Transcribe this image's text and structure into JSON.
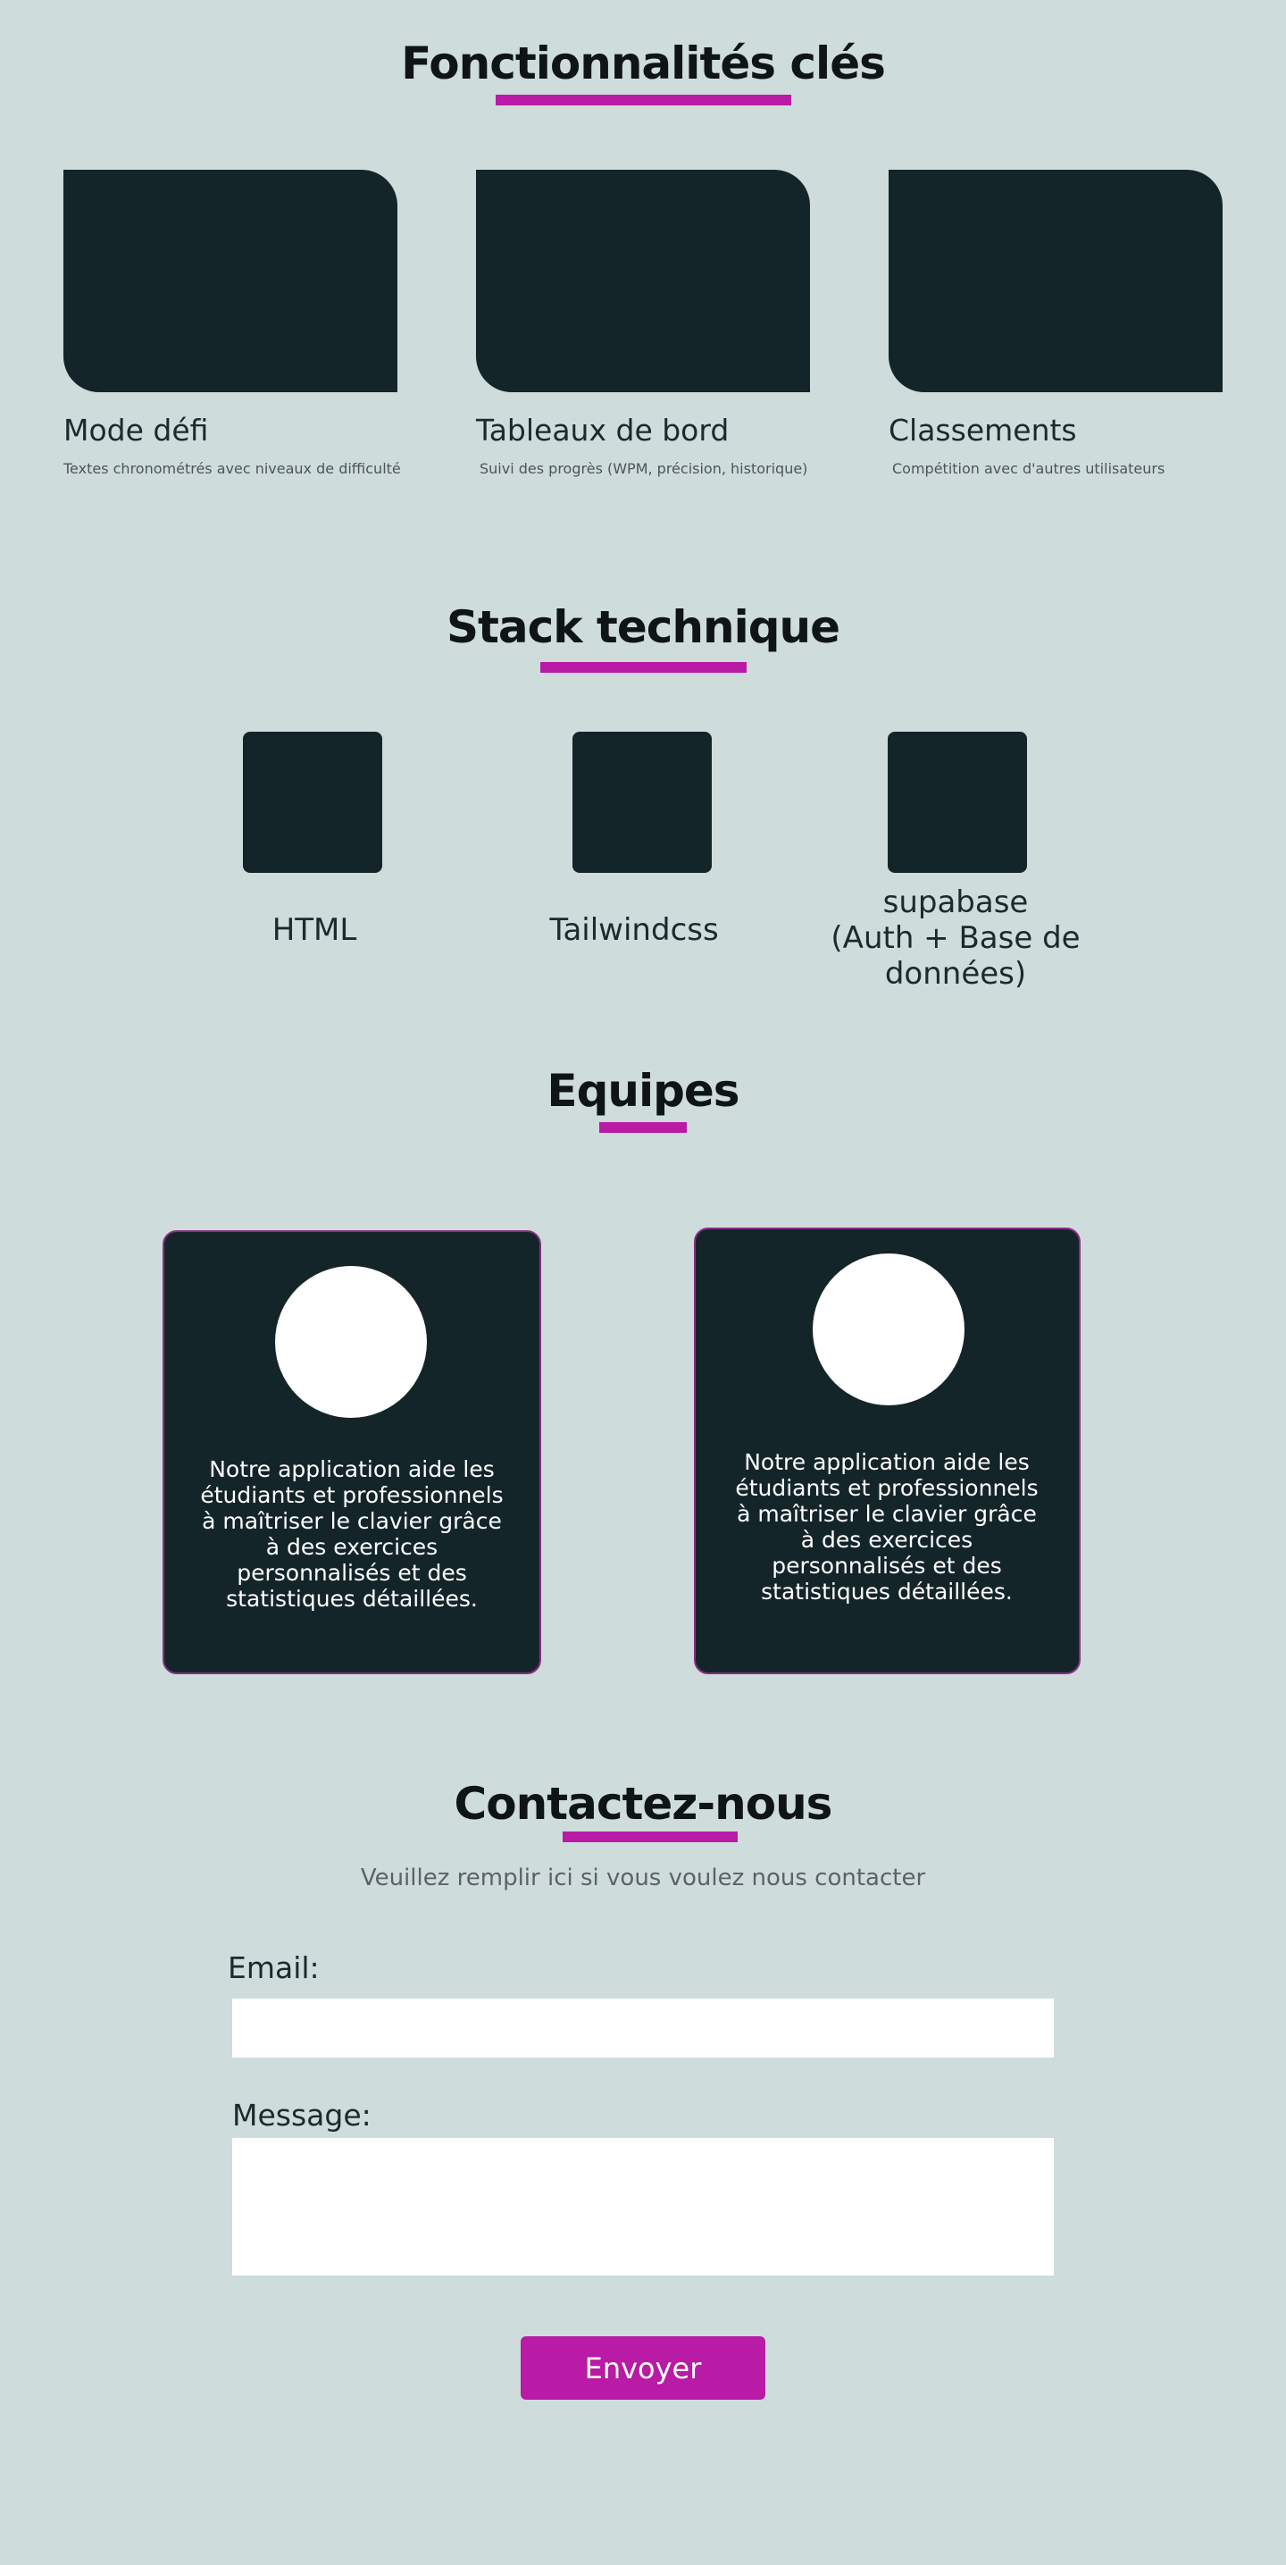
{
  "features": {
    "title": "Fonctionnalités clés",
    "items": [
      {
        "title": "Mode défi",
        "desc": "Textes chronométrés avec niveaux de difficulté"
      },
      {
        "title": "Tableaux de bord",
        "desc": "Suivi des progrès (WPM, précision, historique)"
      },
      {
        "title": "Classements",
        "desc": "Compétition avec d'autres utilisateurs"
      }
    ]
  },
  "stack": {
    "title": "Stack technique",
    "items": [
      {
        "label": "HTML"
      },
      {
        "label": "Tailwindcss"
      },
      {
        "label_line1": "supabase",
        "label_line2": "(Auth + Base de données)"
      }
    ]
  },
  "team": {
    "title": "Equipes",
    "members": [
      {
        "text": "Notre application aide les étudiants et professionnels à maîtriser le clavier grâce à des exercices personnalisés et des statistiques détaillées."
      },
      {
        "text": "Notre application aide les étudiants et professionnels à maîtriser le clavier grâce à des exercices personnalisés et des statistiques détaillées."
      }
    ]
  },
  "contact": {
    "title": "Contactez-nous",
    "subtitle": "Veuillez remplir ici si vous voulez nous contacter",
    "email_label": "Email:",
    "email_value": "",
    "message_label": "Message:",
    "message_value": "",
    "submit_label": "Envoyer"
  },
  "colors": {
    "background": "#cfdcdc",
    "accent": "#b91aa6",
    "card": "#142529"
  }
}
